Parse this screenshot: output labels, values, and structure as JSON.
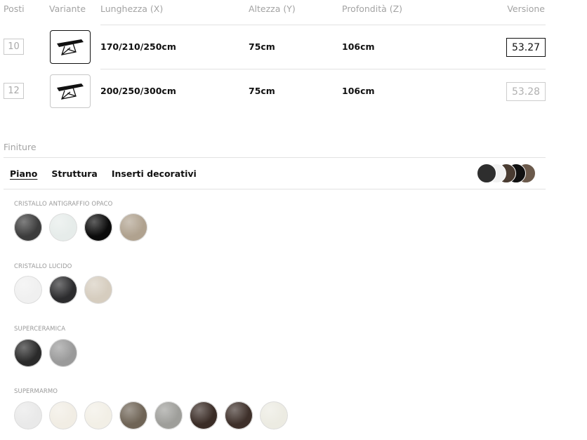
{
  "table": {
    "headers": {
      "posti": "Posti",
      "variante": "Variante",
      "lunghezza": "Lunghezza (X)",
      "altezza": "Altezza (Y)",
      "profondita": "Profondità (Z)",
      "versione": "Versione"
    },
    "rows": [
      {
        "posti": "10",
        "variant_icon": "table-icon",
        "lunghezza": "170/210/250cm",
        "altezza": "75cm",
        "profondita": "106cm",
        "versione": "53.27",
        "selected": true
      },
      {
        "posti": "12",
        "variant_icon": "table-icon",
        "lunghezza": "200/250/300cm",
        "altezza": "75cm",
        "profondita": "106cm",
        "versione": "53.28",
        "selected": false
      }
    ]
  },
  "finiture": {
    "title": "Finiture",
    "tabs": [
      "Piano",
      "Struttura",
      "Inserti decorativi"
    ],
    "active_tab": "Piano",
    "preview_colors": [
      "#2e2e2e",
      "#f2f2f2",
      "#4a3c32",
      "#111111",
      "#6b5a4c"
    ],
    "groups": [
      {
        "label": "CRISTALLO ANTIGRAFFIO OPACO",
        "swatches": [
          "#3c3c3c",
          "#e6ecea",
          "#0b0b0b",
          "#b0a28f"
        ]
      },
      {
        "label": "CRISTALLO LUCIDO",
        "swatches": [
          "#f0f0f0",
          "#2c2c2e",
          "#d6cdbf"
        ]
      },
      {
        "label": "SUPERCERAMICA",
        "swatches": [
          "#2a2a2a",
          "#9a9a9a"
        ]
      },
      {
        "label": "SUPERMARMO",
        "swatches": [
          "#e9e9e9",
          "#f1ede4",
          "#f2efe6",
          "#6f6456",
          "#9e9e9a",
          "#3a2c26",
          "#3e302a",
          "#ecebe2"
        ]
      }
    ]
  }
}
